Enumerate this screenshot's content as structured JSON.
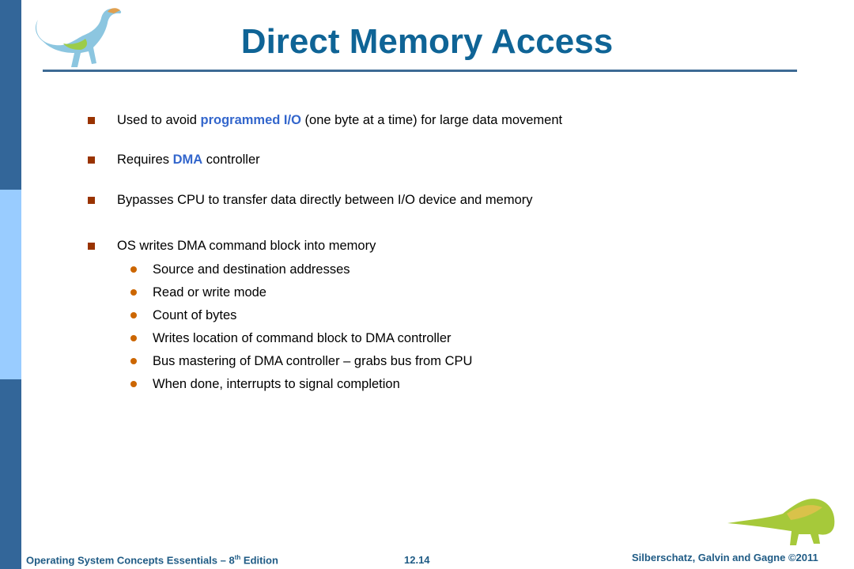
{
  "slide": {
    "title": "Direct Memory Access",
    "bullets": [
      {
        "pre": "Used to avoid ",
        "highlight": "programmed I/O",
        "post": " (one byte at a time) for large data movement"
      },
      {
        "pre": "Requires ",
        "highlight": "DMA",
        "post": " controller"
      },
      {
        "text": "Bypasses CPU to transfer data directly between I/O device and memory"
      },
      {
        "text": "OS writes DMA command block into memory"
      }
    ],
    "sub_bullets": [
      "Source and destination addresses",
      "Read or write mode",
      "Count of bytes",
      "Writes location of command block to DMA controller",
      "Bus mastering of DMA controller – grabs bus from CPU",
      "When done, interrupts to signal completion"
    ]
  },
  "footer": {
    "book_pre": "Operating System Concepts Essentials – 8",
    "book_sup": "th",
    "book_post": " Edition",
    "page": "12.14",
    "copyright": "Silberschatz, Galvin and Gagne ©2011"
  },
  "icons": {
    "top": "dinosaur-icon",
    "bottom": "dinosaur-icon"
  },
  "colors": {
    "title": "#0f6496",
    "highlight": "#3366cc",
    "bullet_square": "#993300",
    "bullet_dot": "#cc6600",
    "sidebar_dark": "#336699",
    "sidebar_light": "#99ccff"
  }
}
